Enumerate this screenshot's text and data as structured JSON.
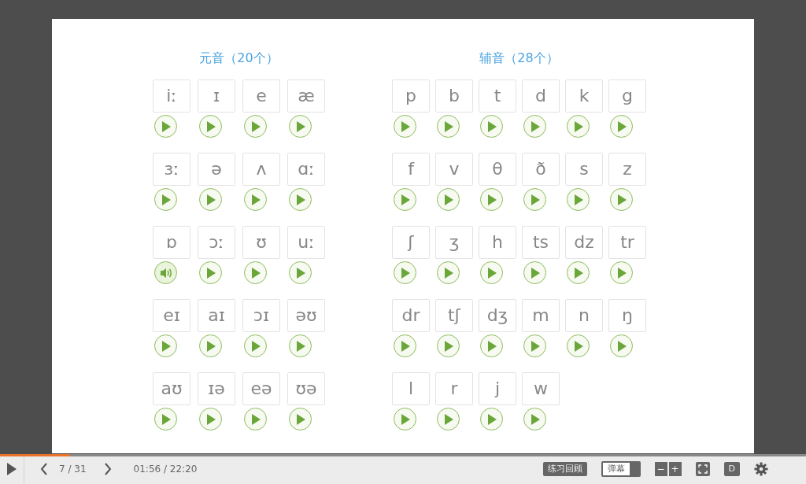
{
  "sections": [
    {
      "kind": "vowels",
      "title": "元音（20个）",
      "phonemes": [
        {
          "symbol": "iː",
          "playing": false
        },
        {
          "symbol": "ɪ",
          "playing": false
        },
        {
          "symbol": "e",
          "playing": false
        },
        {
          "symbol": "æ",
          "playing": false
        },
        {
          "symbol": "ɜː",
          "playing": false
        },
        {
          "symbol": "ə",
          "playing": false
        },
        {
          "symbol": "ʌ",
          "playing": false
        },
        {
          "symbol": "ɑː",
          "playing": false
        },
        {
          "symbol": "ɒ",
          "playing": true
        },
        {
          "symbol": "ɔː",
          "playing": false
        },
        {
          "symbol": "ʊ",
          "playing": false
        },
        {
          "symbol": "uː",
          "playing": false
        },
        {
          "symbol": "eɪ",
          "playing": false
        },
        {
          "symbol": "aɪ",
          "playing": false
        },
        {
          "symbol": "ɔɪ",
          "playing": false
        },
        {
          "symbol": "əʊ",
          "playing": false
        },
        {
          "symbol": "aʊ",
          "playing": false
        },
        {
          "symbol": "ɪə",
          "playing": false
        },
        {
          "symbol": "eə",
          "playing": false
        },
        {
          "symbol": "ʊə",
          "playing": false
        }
      ]
    },
    {
      "kind": "consonants",
      "title": "辅音（28个）",
      "phonemes": [
        {
          "symbol": "p",
          "playing": false
        },
        {
          "symbol": "b",
          "playing": false
        },
        {
          "symbol": "t",
          "playing": false
        },
        {
          "symbol": "d",
          "playing": false
        },
        {
          "symbol": "k",
          "playing": false
        },
        {
          "symbol": "g",
          "playing": false
        },
        {
          "symbol": "f",
          "playing": false
        },
        {
          "symbol": "v",
          "playing": false
        },
        {
          "symbol": "θ",
          "playing": false
        },
        {
          "symbol": "ð",
          "playing": false
        },
        {
          "symbol": "s",
          "playing": false
        },
        {
          "symbol": "z",
          "playing": false
        },
        {
          "symbol": "ʃ",
          "playing": false
        },
        {
          "symbol": "ʒ",
          "playing": false
        },
        {
          "symbol": "h",
          "playing": false
        },
        {
          "symbol": "ts",
          "playing": false
        },
        {
          "symbol": "dz",
          "playing": false
        },
        {
          "symbol": "tr",
          "playing": false
        },
        {
          "symbol": "dr",
          "playing": false
        },
        {
          "symbol": "tʃ",
          "playing": false
        },
        {
          "symbol": "dʒ",
          "playing": false
        },
        {
          "symbol": "m",
          "playing": false
        },
        {
          "symbol": "n",
          "playing": false
        },
        {
          "symbol": "ŋ",
          "playing": false
        },
        {
          "symbol": "l",
          "playing": false
        },
        {
          "symbol": "r",
          "playing": false
        },
        {
          "symbol": "j",
          "playing": false
        },
        {
          "symbol": "w",
          "playing": false
        }
      ]
    }
  ],
  "player": {
    "progress": {
      "level": 0.087
    },
    "page": "7 / 31",
    "time": "01:56 / 22:20",
    "controls": [
      {
        "kind": "button",
        "label": "练习回顾"
      },
      {
        "kind": "toggle",
        "label": "弹幕",
        "on": true
      },
      {
        "kind": "zoom",
        "minus": "−",
        "plus": "+"
      },
      {
        "kind": "fullscreen"
      },
      {
        "kind": "button",
        "label": "D"
      },
      {
        "kind": "settings"
      }
    ]
  }
}
